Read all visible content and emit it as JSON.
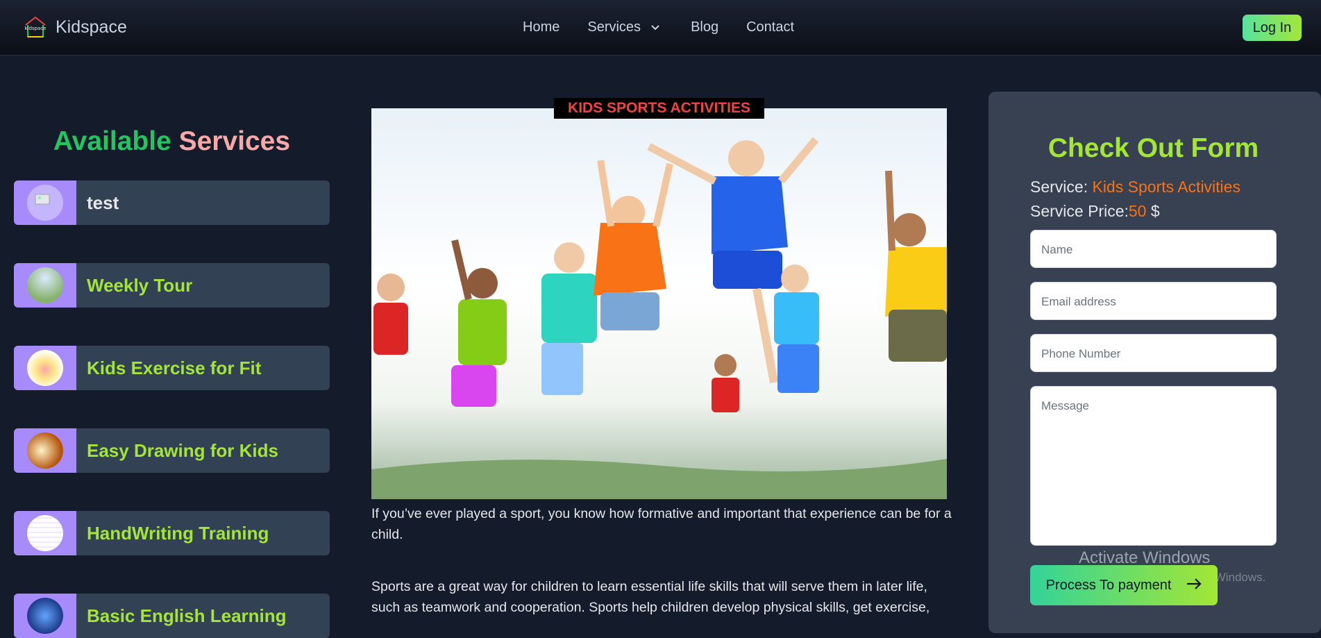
{
  "nav": {
    "brand": "Kidspace",
    "logo_text": "kidspace",
    "links": [
      "Home",
      "Services",
      "Blog",
      "Contact"
    ],
    "login_label": "Log In"
  },
  "sidebar": {
    "heading_part1": "Available",
    "heading_part2": "Services",
    "items": [
      {
        "label": "test"
      },
      {
        "label": "Weekly Tour"
      },
      {
        "label": "Kids Exercise for Fit"
      },
      {
        "label": "Easy Drawing for Kids"
      },
      {
        "label": "HandWriting Training"
      },
      {
        "label": "Basic English Learning"
      }
    ]
  },
  "main": {
    "title": "KIDS SPORTS ACTIVITIES",
    "paragraph1": "If you’ve ever played a sport, you know how formative and important that experience can be for a child.",
    "paragraph2": "Sports are a great way for children to learn essential life skills that will serve them in later life, such as teamwork and cooperation. Sports help children develop physical skills, get exercise,"
  },
  "form": {
    "title": "Check Out Form",
    "service_label": "Service:",
    "service_value": "Kids Sports Activities",
    "price_label": "Service Price:",
    "price_value": "50",
    "currency": "$",
    "name_placeholder": "Name",
    "email_placeholder": "Email address",
    "phone_placeholder": "Phone Number",
    "message_placeholder": "Message",
    "submit_label": "Process To payment"
  },
  "watermark": {
    "line1": "Activate Windows",
    "line2": "Go to Settings to activate Windows."
  },
  "colors": {
    "background": "#141b2b",
    "accent_lime": "#a3e635",
    "accent_green": "#22c55e",
    "accent_orange": "#f97316",
    "title_red": "#ef4444",
    "thumb_purple": "#a78bfa"
  }
}
